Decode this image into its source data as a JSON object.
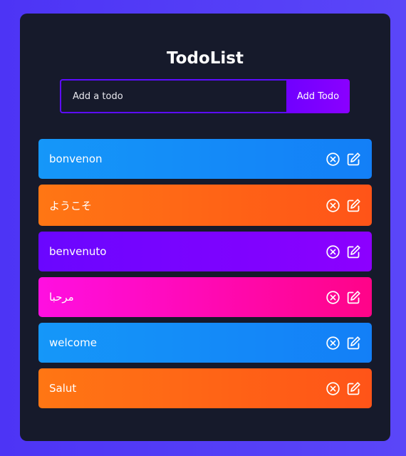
{
  "app": {
    "title": "TodoList"
  },
  "form": {
    "placeholder": "Add a todo",
    "add_label": "Add Todo"
  },
  "todos": [
    {
      "text": "bonvenon",
      "color": "blue"
    },
    {
      "text": "ようこそ",
      "color": "orange"
    },
    {
      "text": "benvenuto",
      "color": "purple"
    },
    {
      "text": "مرحبا",
      "color": "pink"
    },
    {
      "text": "welcome",
      "color": "blue"
    },
    {
      "text": "Salut",
      "color": "orange"
    }
  ],
  "icons": {
    "delete": "close-circle-icon",
    "edit": "edit-icon"
  },
  "colors": {
    "background": "#4d34f5",
    "panel": "#161a2b",
    "input_border": "#5d0cff",
    "button": "#7f00ff",
    "blue": "#1597f9",
    "orange": "#ff6a16",
    "purple": "#7a04ff",
    "pink": "#ff08b8"
  }
}
